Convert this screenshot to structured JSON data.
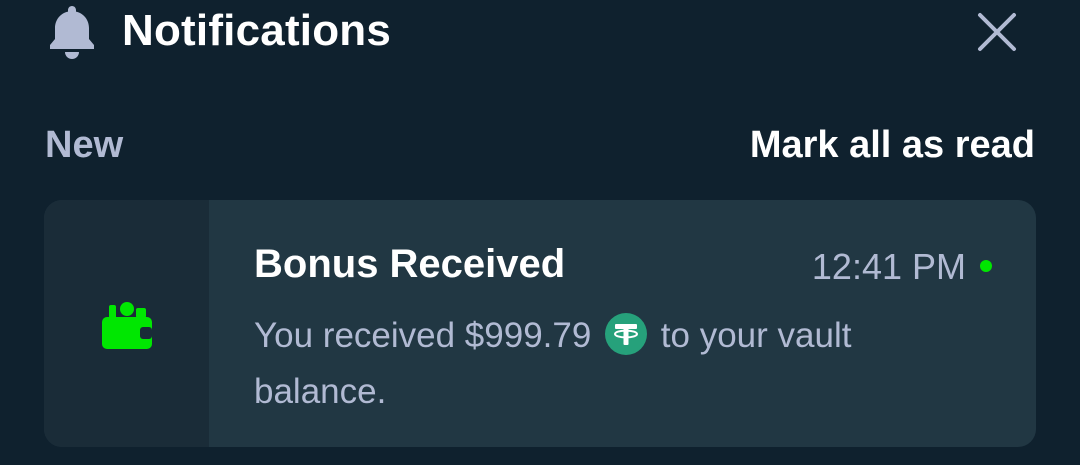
{
  "header": {
    "title": "Notifications",
    "bell_icon": "bell-icon",
    "close_icon": "close-icon"
  },
  "section": {
    "label": "New",
    "mark_all_label": "Mark all as read"
  },
  "notification": {
    "icon": "wallet-icon",
    "title": "Bonus Received",
    "time": "12:41 PM",
    "unread": true,
    "text_before": "You received $999.79",
    "currency_icon": "tether-icon",
    "text_after": "to your vault balance."
  },
  "colors": {
    "background": "#0f212e",
    "card": "#213743",
    "card_icon_column": "#1a2c38",
    "accent_green": "#00e701",
    "tether_green": "#26a17b",
    "muted_text": "#b1bad3"
  }
}
